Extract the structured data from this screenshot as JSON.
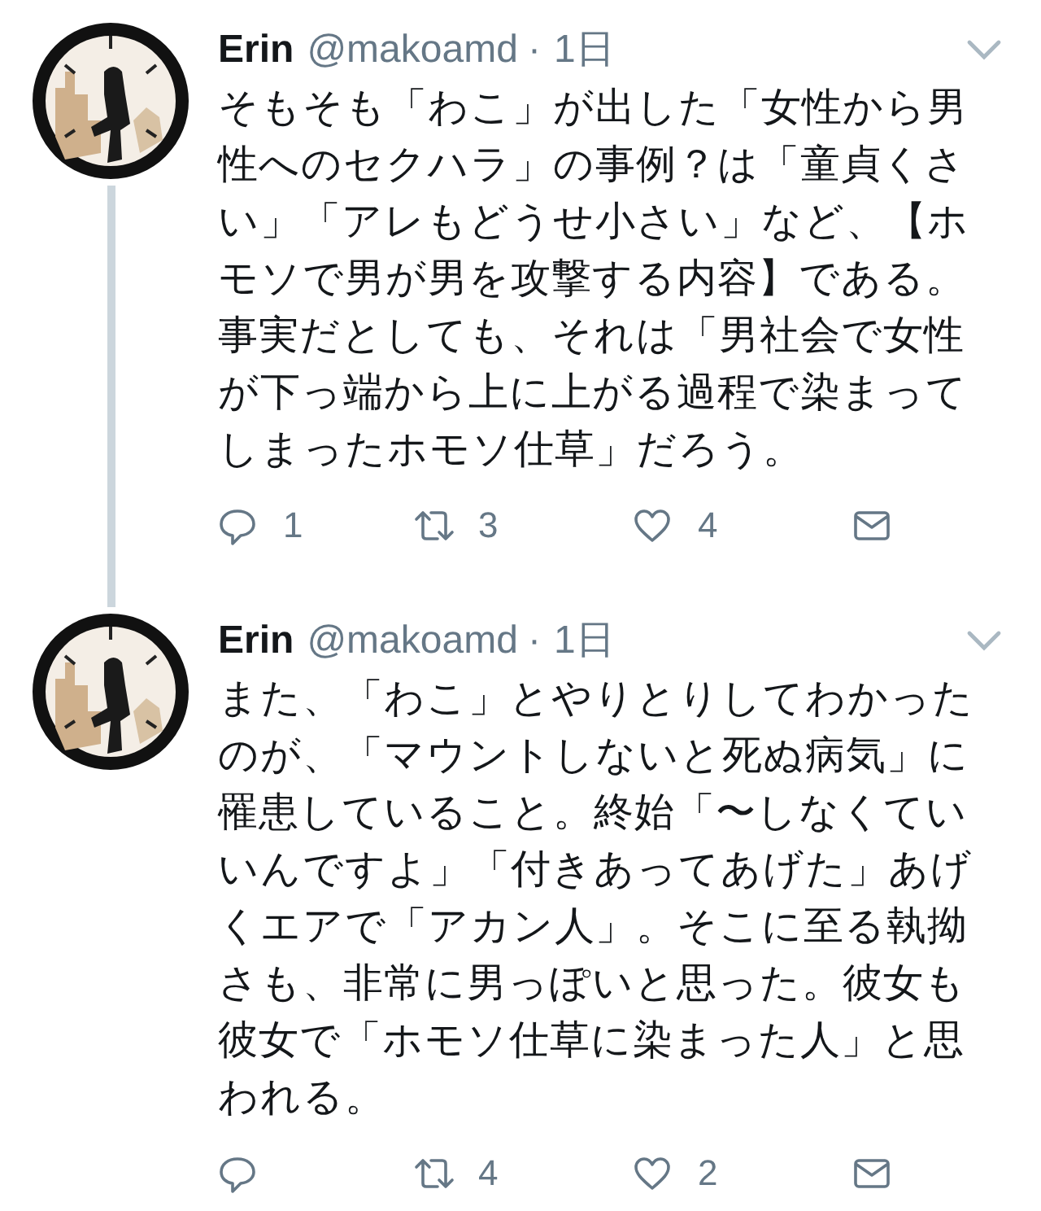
{
  "tweets": [
    {
      "name": "Erin",
      "handle": "@makoamd",
      "separator": "·",
      "time": "1日",
      "thread_continues": true,
      "text": "そもそも「わこ」が出した「女性から男性へのセクハラ」の事例？は「童貞くさい」「アレもどうせ小さい」など、【ホモソで男が男を攻撃する内容】である。事実だとしても、それは「男社会で女性が下っ端から上に上がる過程で染まってしまったホモソ仕草」だろう。",
      "replies": "1",
      "retweets": "3",
      "likes": "4"
    },
    {
      "name": "Erin",
      "handle": "@makoamd",
      "separator": "·",
      "time": "1日",
      "thread_continues": false,
      "text": "また、「わこ」とやりとりしてわかったのが、「マウントしないと死ぬ病気」に罹患していること。終始「〜しなくていいんですよ」「付きあってあげた」あげくエアで「アカン人」。そこに至る執拗さも、非常に男っぽいと思った。彼女も彼女で「ホモソ仕草に染まった人」と思われる。",
      "retweets": "4",
      "likes": "2"
    }
  ]
}
